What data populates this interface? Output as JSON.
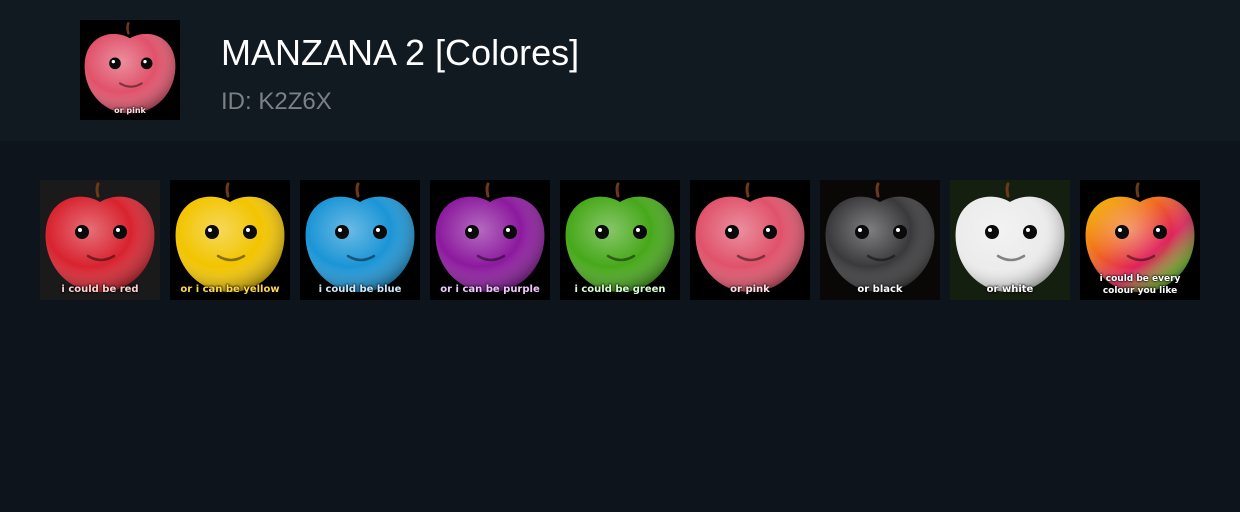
{
  "header": {
    "title": "MANZANA 2 [Colores]",
    "id_text": "ID: K2Z6X",
    "thumb": {
      "color": "#e0526a",
      "caption": "or pink",
      "caption_color": "#ffe0e6"
    }
  },
  "frames": [
    {
      "name": "red",
      "color": "#d8232f",
      "caption": "i could be red",
      "caption_color": "#ffd0d0",
      "bg": "#1a1a1a"
    },
    {
      "name": "yellow",
      "color": "#f2c400",
      "caption": "or i can be yellow",
      "caption_color": "#ffd84a",
      "bg": "#000000"
    },
    {
      "name": "blue",
      "color": "#1b95d6",
      "caption": "i could be blue",
      "caption_color": "#cfeaff",
      "bg": "#000000"
    },
    {
      "name": "purple",
      "color": "#8c1a9e",
      "caption": "or i can be purple",
      "caption_color": "#f0c8ff",
      "bg": "#000000"
    },
    {
      "name": "green",
      "color": "#47a81a",
      "caption": "i could be green",
      "caption_color": "#d8ffd0",
      "bg": "#000000"
    },
    {
      "name": "pink",
      "color": "#e0526a",
      "caption": "or pink",
      "caption_color": "#ffe0e6",
      "bg": "#000000"
    },
    {
      "name": "black",
      "color": "#3a3a3c",
      "caption": "or black",
      "caption_color": "#ffffff",
      "bg": "#0a0807"
    },
    {
      "name": "white",
      "color": "#ececec",
      "caption": "or white",
      "caption_color": "#ffffff",
      "bg": "#141f10"
    },
    {
      "name": "rainbow",
      "color": "#e85a2a",
      "caption": "i could be every colour you like",
      "caption_color": "#ffffff",
      "bg": "#000000"
    }
  ]
}
